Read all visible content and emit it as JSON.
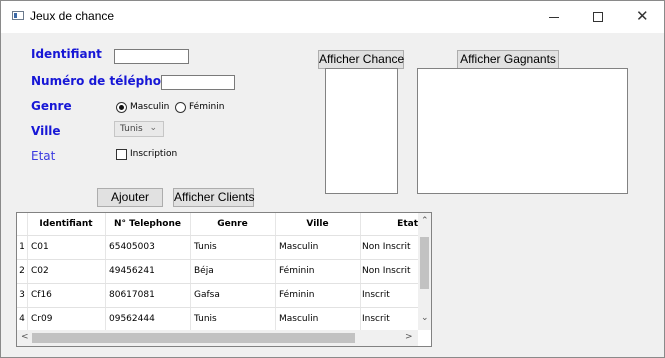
{
  "window": {
    "title": "Jeux de chance",
    "minimize_glyph": "—",
    "maximize_glyph": "☐",
    "close_glyph": "✕"
  },
  "form": {
    "identifiant_label": "Identifiant",
    "identifiant_value": "",
    "telephone_label": "Numéro de téléphone",
    "telephone_value": "",
    "genre_label": "Genre",
    "genre_options": [
      "Masculin",
      "Féminin"
    ],
    "genre_selected": "Masculin",
    "ville_label": "Ville",
    "ville_value": "Tunis",
    "etat_label": "Etat",
    "inscription_label": "Inscription",
    "inscription_checked": false
  },
  "buttons": {
    "ajouter": "Ajouter",
    "afficher_clients": "Afficher Clients",
    "afficher_chance": "Afficher Chance",
    "afficher_gagnants": "Afficher Gagnants"
  },
  "table": {
    "columns": [
      "Identifiant",
      "N° Telephone",
      "Genre",
      "Ville",
      "Etat"
    ],
    "rows": [
      {
        "num": "1",
        "cells": [
          "C01",
          "65405003",
          "Tunis",
          "Masculin",
          "Non Inscrit"
        ]
      },
      {
        "num": "2",
        "cells": [
          "C02",
          "49456241",
          "Béja",
          "Féminin",
          "Non Inscrit"
        ]
      },
      {
        "num": "3",
        "cells": [
          "Cf16",
          "80617081",
          "Gafsa",
          "Féminin",
          "Inscrit"
        ]
      },
      {
        "num": "4",
        "cells": [
          "Cr09",
          "09562444",
          "Tunis",
          "Masculin",
          "Inscrit"
        ]
      }
    ]
  },
  "icons": {
    "combo_chevron": "chevron-down-icon",
    "scroll_up": "⌃",
    "scroll_down": "⌄",
    "scroll_left": "<",
    "scroll_right": ">"
  },
  "colors": {
    "label_blue": "#1717d6",
    "etat_blue": "#3a3ae0"
  }
}
